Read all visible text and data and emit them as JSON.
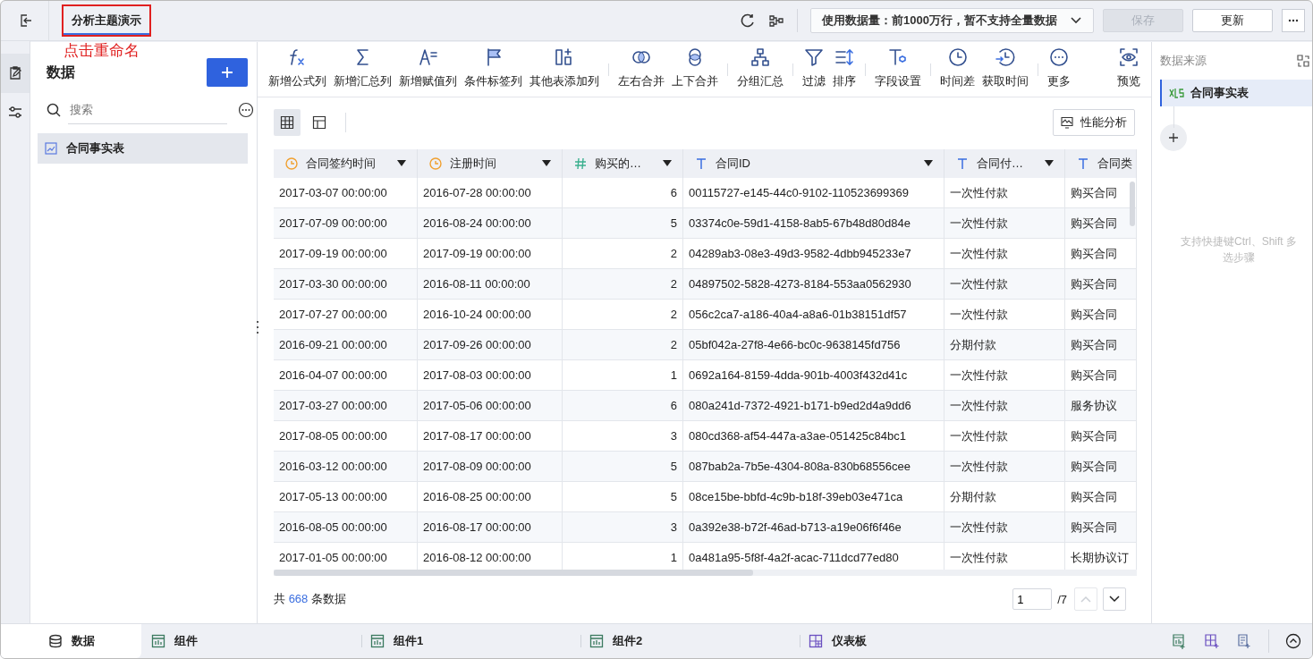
{
  "top_bar": {
    "title": "分析主题演示",
    "annotation": "点击重命名",
    "data_limit": "使用数据量：前1000万行，暂不支持全量数据",
    "buttons": [
      {
        "label": "保存",
        "disabled": true
      },
      {
        "label": "更新",
        "disabled": false
      }
    ]
  },
  "left_rail": [
    {
      "selected": true
    },
    {
      "selected": false
    }
  ],
  "left_panel": {
    "title": "数据",
    "search": {
      "placeholder": "搜索"
    },
    "items": [
      {
        "label": "合同事实表",
        "selected": true
      }
    ]
  },
  "toolbar": [
    {
      "items": [
        "新增公式列",
        "新增汇总列",
        "新增赋值列",
        "条件标签列",
        "其他表添加列"
      ]
    },
    {
      "items": [
        "左右合并",
        "上下合并"
      ]
    },
    {
      "items": [
        "分组汇总"
      ]
    },
    {
      "items": [
        "过滤",
        "排序"
      ]
    },
    {
      "items": [
        "字段设置"
      ]
    },
    {
      "items": [
        "时间差",
        "获取时间"
      ]
    },
    {
      "items": [
        "更多"
      ]
    },
    {
      "items": [
        "预览"
      ]
    }
  ],
  "view_toggles": [
    {
      "selected": true
    },
    {
      "selected": false
    }
  ],
  "perf_button": "性能分析",
  "table": {
    "columns": [
      {
        "label": "合同签约时间",
        "kind": "date"
      },
      {
        "label": "注册时间",
        "kind": "date"
      },
      {
        "label": "购买的…",
        "kind": "number"
      },
      {
        "label": "合同ID",
        "kind": "text"
      },
      {
        "label": "合同付…",
        "kind": "text"
      },
      {
        "label": "合同类",
        "kind": "text"
      }
    ],
    "rows": [
      [
        "2017-03-07 00:00:00",
        "2016-07-28 00:00:00",
        "6",
        "00115727-e145-44c0-9102-110523699369",
        "一次性付款",
        "购买合同"
      ],
      [
        "2017-07-09 00:00:00",
        "2016-08-24 00:00:00",
        "5",
        "03374c0e-59d1-4158-8ab5-67b48d80d84e",
        "一次性付款",
        "购买合同"
      ],
      [
        "2017-09-19 00:00:00",
        "2017-09-19 00:00:00",
        "2",
        "04289ab3-08e3-49d3-9582-4dbb945233e7",
        "一次性付款",
        "购买合同"
      ],
      [
        "2017-03-30 00:00:00",
        "2016-08-11 00:00:00",
        "2",
        "04897502-5828-4273-8184-553aa0562930",
        "一次性付款",
        "购买合同"
      ],
      [
        "2017-07-27 00:00:00",
        "2016-10-24 00:00:00",
        "2",
        "056c2ca7-a186-40a4-a8a6-01b38151df57",
        "一次性付款",
        "购买合同"
      ],
      [
        "2016-09-21 00:00:00",
        "2017-09-26 00:00:00",
        "2",
        "05bf042a-27f8-4e66-bc0c-9638145fd756",
        "分期付款",
        "购买合同"
      ],
      [
        "2016-04-07 00:00:00",
        "2017-08-03 00:00:00",
        "1",
        "0692a164-8159-4dda-901b-4003f432d41c",
        "一次性付款",
        "购买合同"
      ],
      [
        "2017-03-27 00:00:00",
        "2017-05-06 00:00:00",
        "6",
        "080a241d-7372-4921-b171-b9ed2d4a9dd6",
        "一次性付款",
        "服务协议"
      ],
      [
        "2017-08-05 00:00:00",
        "2017-08-17 00:00:00",
        "3",
        "080cd368-af54-447a-a3ae-051425c84bc1",
        "一次性付款",
        "购买合同"
      ],
      [
        "2016-03-12 00:00:00",
        "2017-08-09 00:00:00",
        "5",
        "087bab2a-7b5e-4304-808a-830b68556cee",
        "一次性付款",
        "购买合同"
      ],
      [
        "2017-05-13 00:00:00",
        "2016-08-25 00:00:00",
        "5",
        "08ce15be-bbfd-4c9b-b18f-39eb03e471ca",
        "分期付款",
        "购买合同"
      ],
      [
        "2016-08-05 00:00:00",
        "2016-08-17 00:00:00",
        "3",
        "0a392e38-b72f-46ad-b713-a19e06f6f46e",
        "一次性付款",
        "购买合同"
      ],
      [
        "2017-01-05 00:00:00",
        "2016-08-12 00:00:00",
        "1",
        "0a481a95-5f8f-4a2f-acac-711dcd77ed80",
        "一次性付款",
        "长期协议订"
      ]
    ]
  },
  "footer": {
    "prefix": "共",
    "count": "668",
    "suffix": "条数据",
    "page": "1",
    "pages": "/7",
    "prev_disabled": true
  },
  "right_panel": {
    "title": "数据来源",
    "items": [
      {
        "label": "合同事实表",
        "selected": true
      }
    ],
    "hint": "支持快捷键Ctrl、Shift 多选步骤"
  },
  "bottom_tabs": [
    {
      "label": "数据",
      "kind": "data",
      "selected": true
    },
    {
      "label": "组件",
      "kind": "component",
      "selected": false
    },
    {
      "label": "组件1",
      "kind": "component",
      "selected": false
    },
    {
      "label": "组件2",
      "kind": "component",
      "selected": false
    },
    {
      "label": "仪表板",
      "kind": "dashboard",
      "selected": false
    }
  ]
}
